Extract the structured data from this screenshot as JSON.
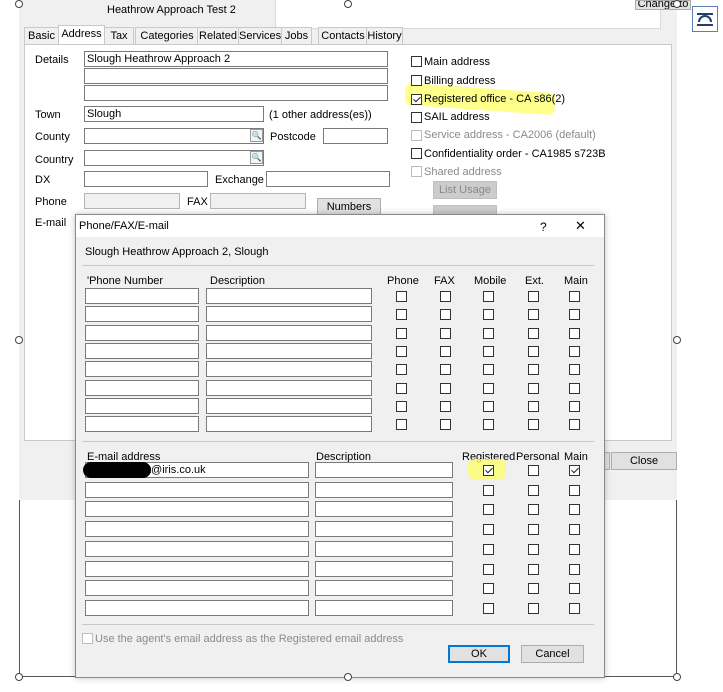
{
  "window": {
    "title": "Heathrow Approach Test 2",
    "change_to_label": "Change to"
  },
  "tabs": [
    "Basic",
    "Address",
    "Tax",
    "Categories",
    "Related",
    "Services",
    "Jobs",
    "Contacts",
    "History"
  ],
  "address": {
    "details_label": "Details",
    "details_lines": [
      "Slough Heathrow Approach 2",
      "",
      ""
    ],
    "town_label": "Town",
    "town_value": "Slough",
    "other_addresses": "(1 other address(es))",
    "county_label": "County",
    "postcode_label": "Postcode",
    "country_label": "Country",
    "dx_label": "DX",
    "exchange_label": "Exchange",
    "phone_label": "Phone",
    "fax_label": "FAX",
    "email_label": "E-mail",
    "numbers_button": "Numbers"
  },
  "address_flags": [
    {
      "label": "Main address",
      "checked": false,
      "enabled": true
    },
    {
      "label": "Billing address",
      "checked": false,
      "enabled": true
    },
    {
      "label": "Registered office - CA s86(2)",
      "checked": true,
      "enabled": true,
      "highlight": true
    },
    {
      "label": "SAIL address",
      "checked": false,
      "enabled": true
    },
    {
      "label": "Service address - CA2006 (default)",
      "checked": false,
      "enabled": false
    },
    {
      "label": "Confidentiality order - CA1985 s723B",
      "checked": false,
      "enabled": true
    },
    {
      "label": "Shared address",
      "checked": false,
      "enabled": false
    }
  ],
  "list_usage_button": "List Usage",
  "close_button": "Close",
  "dialog": {
    "title": "Phone/FAX/E-mail",
    "help": "?",
    "close": "✕",
    "subtitle": "Slough Heathrow Approach 2, Slough",
    "phone_headers": [
      "'Phone Number",
      "Description",
      "Phone",
      "FAX",
      "Mobile",
      "Ext.",
      "Main"
    ],
    "phone_rows": 8,
    "email_headers": [
      "E-mail address",
      "Description",
      "Registered",
      "Personal",
      "Main"
    ],
    "email_first_value": "t@iris.co.uk",
    "email_rows": [
      {
        "registered": true,
        "personal": false,
        "main": true
      },
      {
        "registered": false,
        "personal": false,
        "main": false
      },
      {
        "registered": false,
        "personal": false,
        "main": false
      },
      {
        "registered": false,
        "personal": false,
        "main": false
      },
      {
        "registered": false,
        "personal": false,
        "main": false
      },
      {
        "registered": false,
        "personal": false,
        "main": false
      },
      {
        "registered": false,
        "personal": false,
        "main": false
      },
      {
        "registered": false,
        "personal": false,
        "main": false
      }
    ],
    "agent_option": "Use the agent's email address as the Registered email address",
    "ok_button": "OK",
    "cancel_button": "Cancel"
  }
}
